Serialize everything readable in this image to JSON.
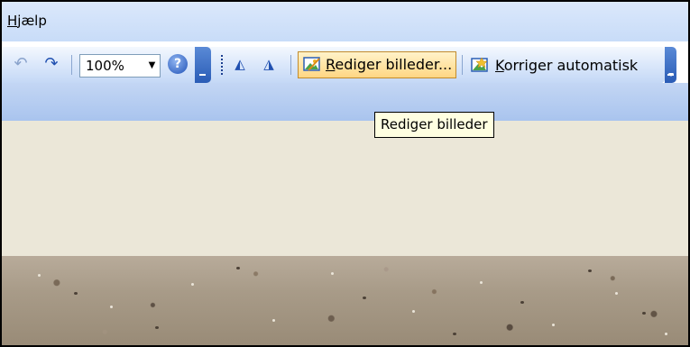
{
  "menubar": {
    "help_first": "H",
    "help_rest": "jælp"
  },
  "toolbar": {
    "zoom": "100%",
    "edit_pictures_label_first": "R",
    "edit_pictures_label_rest": "ediger billeder...",
    "auto_correct_label_first": "K",
    "auto_correct_label_rest": "orriger automatisk",
    "icons": [
      "undo-icon",
      "redo-icon",
      "zoom-dropdown-arrow",
      "help-icon",
      "flip-icon",
      "rotate-icon",
      "edit-pictures-icon",
      "auto-correct-icon"
    ],
    "accent": "#2a5cb6"
  },
  "tooltip": {
    "text": "Rediger billeder"
  }
}
